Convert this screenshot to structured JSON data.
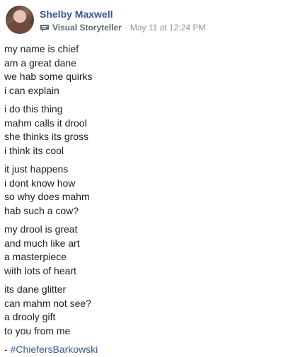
{
  "post": {
    "author": "Shelby Maxwell",
    "badge_icon": "speech-bubble-icon",
    "role": "Visual Storyteller",
    "separator": "·",
    "timestamp": "May 11 at 12:24 PM",
    "stanzas": [
      [
        "my name is chief",
        "am a great dane",
        "we hab some quirks",
        "i can explain"
      ],
      [
        "i do this thing",
        "mahm calls it drool",
        "she thinks its gross",
        "i think its cool"
      ],
      [
        "it just happens",
        "i dont know how",
        "so why does mahm",
        "hab such a cow?"
      ],
      [
        "my drool is great",
        "and much like art",
        "a masterpiece",
        "with lots of heart"
      ],
      [
        "its dane glitter",
        "can mahm not see?",
        "a drooly gift",
        "to you from me"
      ]
    ],
    "hashtag_prefix": "- ",
    "hashtag": "#ChiefersBarkowski"
  },
  "colors": {
    "link": "#385898",
    "text": "#1c1e21",
    "muted": "#90949c"
  }
}
